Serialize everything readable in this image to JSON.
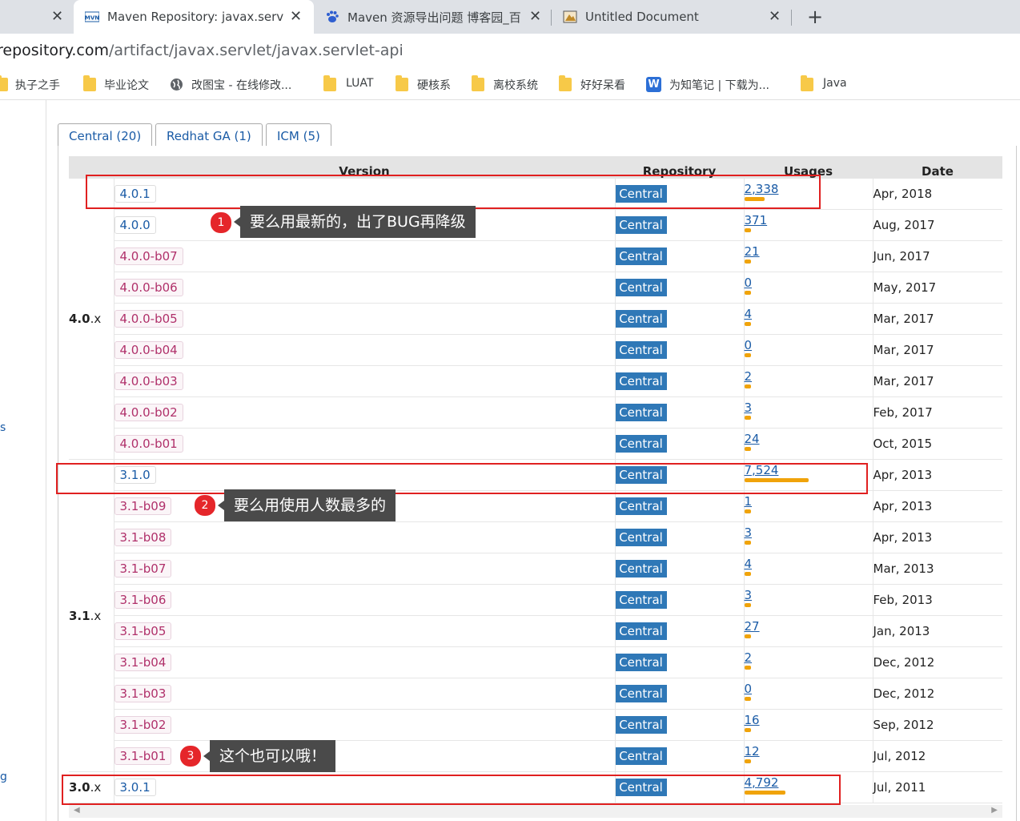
{
  "browser": {
    "tabs": [
      {
        "title": "Maven Repository: javax.servle",
        "active": true,
        "icon": "mvn-favicon"
      },
      {
        "title": "Maven 资源导出问题 博客园_百",
        "active": false,
        "icon": "baidu-paw-icon"
      },
      {
        "title": "Untitled Document",
        "active": false,
        "icon": "document-favicon"
      }
    ],
    "url_host": "repository.com",
    "url_path": "/artifact/javax.servlet/javax.servlet-api",
    "bookmarks": [
      "执子之手",
      "毕业论文",
      "改图宝 - 在线修改...",
      "LUAT",
      "硬核系",
      "离校系统",
      "好好呆看",
      "为知笔记 | 下载为...",
      "Java"
    ]
  },
  "sidebar_fragments": [
    "s",
    "g"
  ],
  "repo_tabs": [
    "Central (20)",
    "Redhat GA (1)",
    "ICM (5)"
  ],
  "table": {
    "headers": {
      "version": "Version",
      "repository": "Repository",
      "usages": "Usages",
      "date": "Date"
    },
    "groups": [
      {
        "major": "4.0",
        "suffix": ".x",
        "rows": [
          {
            "version": "4.0.1",
            "beta": false,
            "repo": "Central",
            "usages": "2,338",
            "usage_share": 0.31,
            "date": "Apr, 2018"
          },
          {
            "version": "4.0.0",
            "beta": false,
            "repo": "Central",
            "usages": "371",
            "usage_share": 0.05,
            "date": "Aug, 2017"
          },
          {
            "version": "4.0.0-b07",
            "beta": true,
            "repo": "Central",
            "usages": "21",
            "usage_share": 0.01,
            "date": "Jun, 2017"
          },
          {
            "version": "4.0.0-b06",
            "beta": true,
            "repo": "Central",
            "usages": "0",
            "usage_share": 0.01,
            "date": "May, 2017"
          },
          {
            "version": "4.0.0-b05",
            "beta": true,
            "repo": "Central",
            "usages": "4",
            "usage_share": 0.01,
            "date": "Mar, 2017"
          },
          {
            "version": "4.0.0-b04",
            "beta": true,
            "repo": "Central",
            "usages": "0",
            "usage_share": 0.01,
            "date": "Mar, 2017"
          },
          {
            "version": "4.0.0-b03",
            "beta": true,
            "repo": "Central",
            "usages": "2",
            "usage_share": 0.01,
            "date": "Mar, 2017"
          },
          {
            "version": "4.0.0-b02",
            "beta": true,
            "repo": "Central",
            "usages": "3",
            "usage_share": 0.01,
            "date": "Feb, 2017"
          },
          {
            "version": "4.0.0-b01",
            "beta": true,
            "repo": "Central",
            "usages": "24",
            "usage_share": 0.01,
            "date": "Oct, 2015"
          }
        ]
      },
      {
        "major": "3.1",
        "suffix": ".x",
        "rows": [
          {
            "version": "3.1.0",
            "beta": false,
            "repo": "Central",
            "usages": "7,524",
            "usage_share": 1.0,
            "date": "Apr, 2013"
          },
          {
            "version": "3.1-b09",
            "beta": true,
            "repo": "Central",
            "usages": "1",
            "usage_share": 0.01,
            "date": "Apr, 2013"
          },
          {
            "version": "3.1-b08",
            "beta": true,
            "repo": "Central",
            "usages": "3",
            "usage_share": 0.01,
            "date": "Apr, 2013"
          },
          {
            "version": "3.1-b07",
            "beta": true,
            "repo": "Central",
            "usages": "4",
            "usage_share": 0.01,
            "date": "Mar, 2013"
          },
          {
            "version": "3.1-b06",
            "beta": true,
            "repo": "Central",
            "usages": "3",
            "usage_share": 0.01,
            "date": "Feb, 2013"
          },
          {
            "version": "3.1-b05",
            "beta": true,
            "repo": "Central",
            "usages": "27",
            "usage_share": 0.01,
            "date": "Jan, 2013"
          },
          {
            "version": "3.1-b04",
            "beta": true,
            "repo": "Central",
            "usages": "2",
            "usage_share": 0.01,
            "date": "Dec, 2012"
          },
          {
            "version": "3.1-b03",
            "beta": true,
            "repo": "Central",
            "usages": "0",
            "usage_share": 0.01,
            "date": "Dec, 2012"
          },
          {
            "version": "3.1-b02",
            "beta": true,
            "repo": "Central",
            "usages": "16",
            "usage_share": 0.01,
            "date": "Sep, 2012"
          },
          {
            "version": "3.1-b01",
            "beta": true,
            "repo": "Central",
            "usages": "12",
            "usage_share": 0.01,
            "date": "Jul, 2012"
          }
        ]
      },
      {
        "major": "3.0",
        "suffix": ".x",
        "rows": [
          {
            "version": "3.0.1",
            "beta": false,
            "repo": "Central",
            "usages": "4,792",
            "usage_share": 0.64,
            "date": "Jul, 2011"
          }
        ]
      }
    ]
  },
  "annotations": [
    {
      "num": "1",
      "text": "要么用最新的，出了BUG再降级"
    },
    {
      "num": "2",
      "text": "要么用使用人数最多的"
    },
    {
      "num": "3",
      "text": "这个也可以哦！"
    }
  ],
  "colors": {
    "accent_red": "#e02020",
    "central_badge": "#2f78b7",
    "usage_bar": "#f0a30a",
    "link": "#1a5ba6"
  }
}
